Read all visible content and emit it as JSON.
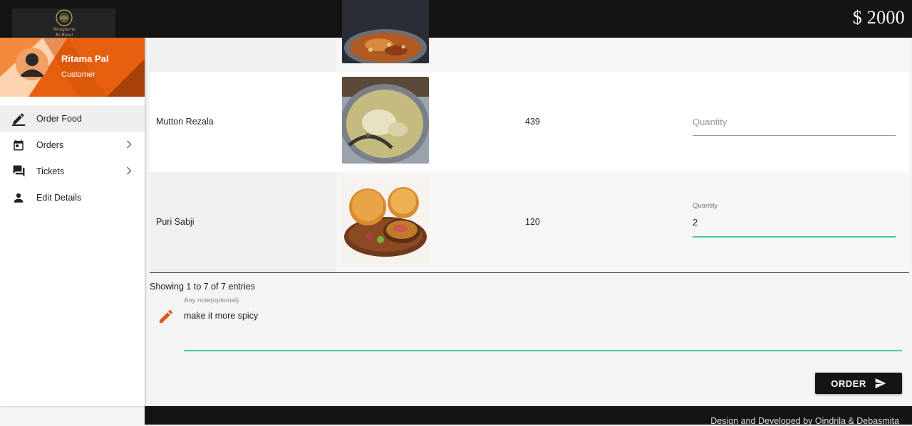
{
  "header": {
    "logo_text": "Annapurna Ki Rasoi",
    "balance": "$ 2000"
  },
  "sidebar": {
    "user_name": "Ritama Pal",
    "user_role": "Customer",
    "items": [
      {
        "label": "Order Food",
        "icon": "pencil-icon",
        "active": true
      },
      {
        "label": "Orders",
        "icon": "calendar-icon",
        "chevron": true
      },
      {
        "label": "Tickets",
        "icon": "chat-icon",
        "chevron": true
      },
      {
        "label": "Edit Details",
        "icon": "person-icon"
      }
    ]
  },
  "table": {
    "rows": [
      {
        "name": "",
        "price": "",
        "quantity": "",
        "quantity_placeholder": ""
      },
      {
        "name": "Mutton Rezala",
        "price": "439",
        "quantity": "",
        "quantity_placeholder": "Quantity"
      },
      {
        "name": "Puri Sabji",
        "price": "120",
        "quantity": "2",
        "quantity_label": "Quantity"
      }
    ],
    "entries_info": "Showing 1 to 7 of 7 entries"
  },
  "note": {
    "label": "Any note(optional)",
    "value": "make it more spicy"
  },
  "order_button": {
    "label": "ORDER"
  },
  "footer": {
    "credits": "Design and Developed by Oindrila & Debasmita"
  },
  "colors": {
    "topbar": "#141414",
    "accent_orange": "#e6600f",
    "active_green": "#3ecf8e",
    "edit_icon": "#e0561c"
  }
}
